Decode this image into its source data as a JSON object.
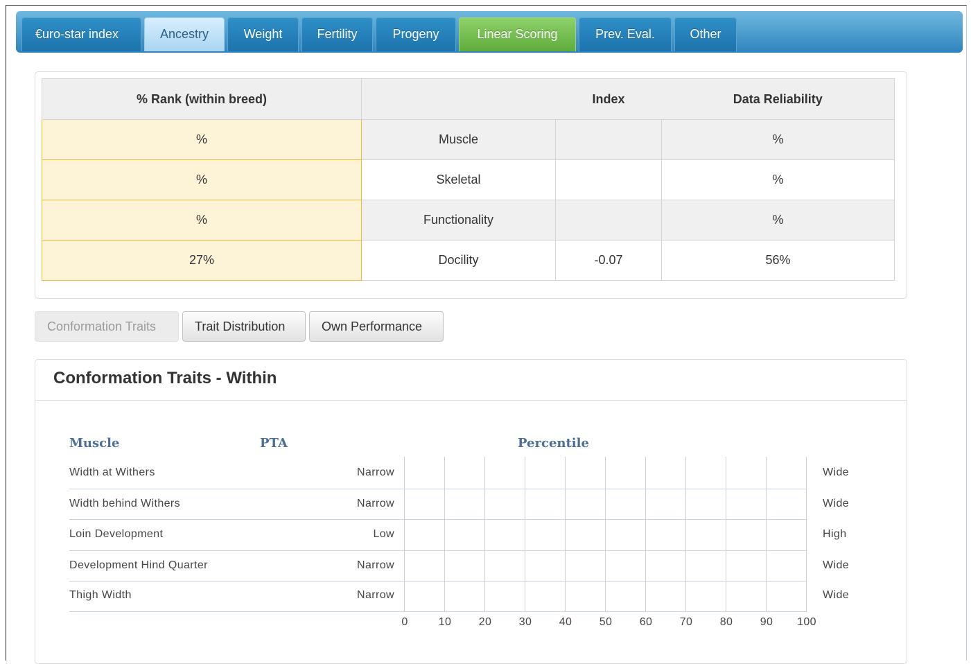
{
  "tabs": [
    {
      "label": "€uro-star index",
      "state": "normal"
    },
    {
      "label": "Ancestry",
      "state": "active"
    },
    {
      "label": "Weight",
      "state": "normal"
    },
    {
      "label": "Fertility",
      "state": "normal"
    },
    {
      "label": "Progeny",
      "state": "normal"
    },
    {
      "label": "Linear Scoring",
      "state": "green"
    },
    {
      "label": "Prev. Eval.",
      "state": "normal"
    },
    {
      "label": "Other",
      "state": "normal"
    }
  ],
  "rank_table": {
    "headers": {
      "rank": "% Rank (within breed)",
      "trait": "",
      "index": "Index",
      "reliability": "Data Reliability"
    },
    "rows": [
      {
        "rank": "%",
        "trait": "Muscle",
        "index": "",
        "reliability": "%"
      },
      {
        "rank": "%",
        "trait": "Skeletal",
        "index": "",
        "reliability": "%"
      },
      {
        "rank": "%",
        "trait": "Functionality",
        "index": "",
        "reliability": "%"
      },
      {
        "rank": "27%",
        "trait": "Docility",
        "index": "-0.07",
        "reliability": "56%"
      }
    ]
  },
  "subtabs": {
    "conformation": "Conformation Traits",
    "distribution": "Trait Distribution",
    "own": "Own Performance"
  },
  "card": {
    "title": "Conformation Traits - Within",
    "headers": {
      "group": "Muscle",
      "pta": "PTA",
      "percentile": "Percentile"
    },
    "traits": [
      {
        "name": "Width at Withers",
        "low": "Narrow",
        "high": "Wide"
      },
      {
        "name": "Width behind Withers",
        "low": "Narrow",
        "high": "Wide"
      },
      {
        "name": "Loin Development",
        "low": "Low",
        "high": "High"
      },
      {
        "name": "Development Hind Quarter",
        "low": "Narrow",
        "high": "Wide"
      },
      {
        "name": "Thigh Width",
        "low": "Narrow",
        "high": "Wide"
      }
    ],
    "scale": [
      "0",
      "10",
      "20",
      "30",
      "40",
      "50",
      "60",
      "70",
      "80",
      "90",
      "100"
    ]
  },
  "colors": {
    "tab_blue": "#1d73ad",
    "tab_green": "#5fac3b",
    "rank_fill": "#fdf3d6",
    "header_blue": "#4d6e96"
  }
}
